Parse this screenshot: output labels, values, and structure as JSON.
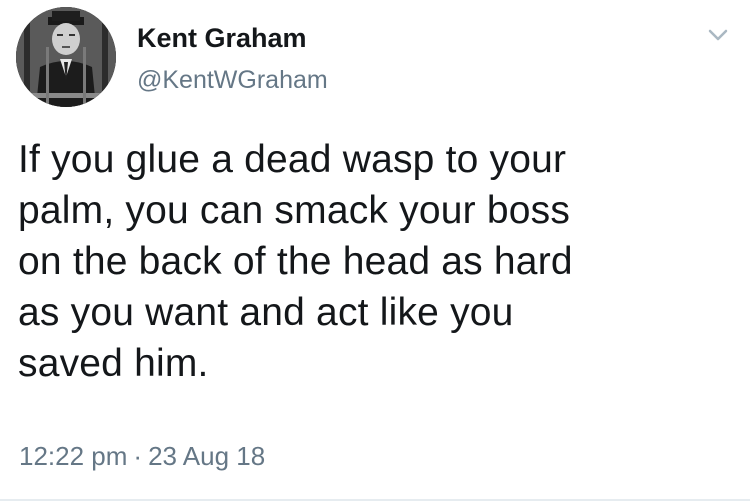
{
  "author": {
    "display_name": "Kent Graham",
    "handle": "@KentWGraham"
  },
  "tweet": {
    "lines": [
      "If you glue a dead wasp to your",
      "palm, you can smack your boss",
      "on the back of the head as hard",
      "as you want and act like you",
      "saved him."
    ],
    "time": "12:22 pm",
    "separator": "·",
    "date": "23 Aug 18"
  },
  "icons": {
    "menu": "chevron-down-icon",
    "avatar": "person-photo-avatar"
  },
  "colors": {
    "text_primary": "#14171a",
    "text_secondary": "#657786",
    "divider": "#e6ecf0"
  }
}
